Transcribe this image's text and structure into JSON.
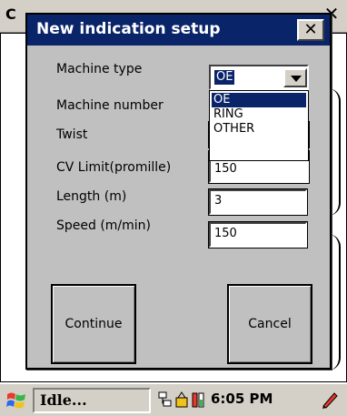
{
  "background_window": {
    "title_char": "C",
    "close_symbol": "✕"
  },
  "dialog": {
    "title": "New indication setup",
    "close_symbol": "✕",
    "fields": {
      "machine_type": {
        "label": "Machine type",
        "value": "OE"
      },
      "machine_number": {
        "label": "Machine number"
      },
      "twist": {
        "label": "Twist"
      },
      "cv_limit": {
        "label": "CV Limit(promille)",
        "value": "150"
      },
      "length": {
        "label": "Length (m)",
        "value": "3"
      },
      "speed": {
        "label": "Speed (m/min)",
        "value": "150"
      }
    },
    "dropdown_options": [
      "OE",
      "RING",
      "OTHER"
    ],
    "selected_option": "OE",
    "continue_label": "Continue",
    "cancel_label": "Cancel"
  },
  "taskbar": {
    "status": "Idle...",
    "time": "6:05 PM",
    "icons": [
      "windows-flag-icon",
      "network-icon",
      "battery-icon",
      "power-icon",
      "pen-icon"
    ]
  },
  "colors": {
    "title_bar": "#0a246a",
    "selection": "#0a246a",
    "dialog_bg": "#c0c0c0"
  }
}
